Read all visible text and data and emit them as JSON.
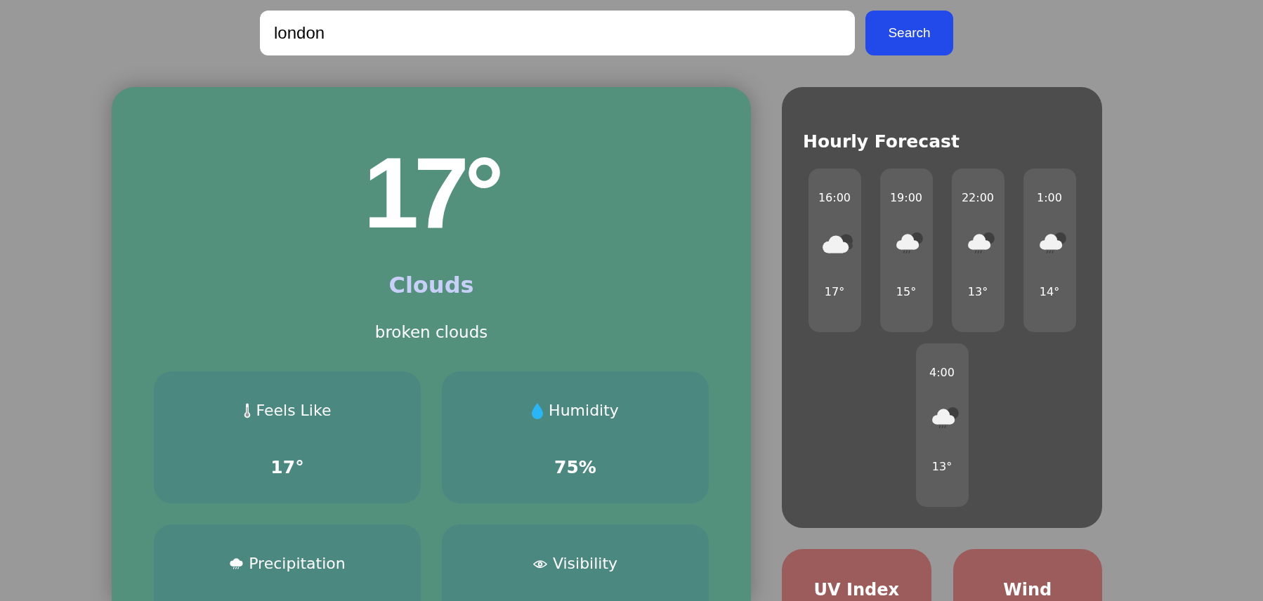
{
  "search": {
    "value": "london",
    "button": "Search"
  },
  "current": {
    "temperature": "17°",
    "condition": "Clouds",
    "description": "broken clouds",
    "details": [
      {
        "kind": "temperature",
        "label": "Feels Like",
        "value": "17°"
      },
      {
        "kind": "humidity",
        "label": "Humidity",
        "value": "75%"
      },
      {
        "kind": "precipitation",
        "label": "Precipitation"
      },
      {
        "kind": "visibility",
        "label": "Visibility"
      }
    ]
  },
  "hourly": {
    "title": "Hourly Forecast",
    "items": [
      {
        "time": "16:00",
        "kind": "cloudy",
        "temperature": "17°"
      },
      {
        "time": "19:00",
        "kind": "rainy",
        "temperature": "15°"
      },
      {
        "time": "22:00",
        "kind": "rainy",
        "temperature": "13°"
      },
      {
        "time": "1:00",
        "kind": "rainy",
        "temperature": "14°"
      },
      {
        "time": "4:00",
        "kind": "rainy",
        "temperature": "13°"
      }
    ]
  },
  "info_cards": [
    {
      "title": "UV Index"
    },
    {
      "title": "Wind"
    }
  ]
}
